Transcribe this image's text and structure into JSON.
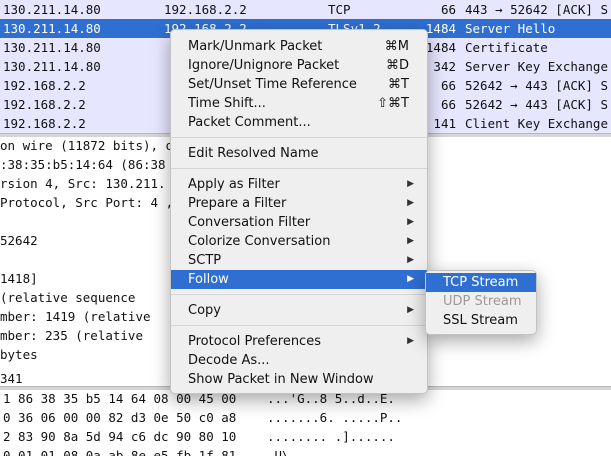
{
  "colors": {
    "selected_row": "#2f6fd1",
    "tcp_row": "#e7e6ff",
    "menu_bg": "#efefef",
    "menu_highlight": "#2f6fd1"
  },
  "packets": [
    {
      "src": "130.211.14.80",
      "dst": "192.168.2.2",
      "proto": "TCP",
      "len": "66",
      "info": "443 → 52642 [ACK] S"
    },
    {
      "src": "130.211.14.80",
      "dst": "192.168.2.2",
      "proto": "TLSv1.2",
      "len": "1484",
      "info": "Server Hello"
    },
    {
      "src": "130.211.14.80",
      "dst": "",
      "proto": "",
      "len": "1484",
      "info": "Certificate"
    },
    {
      "src": "130.211.14.80",
      "dst": "",
      "proto": "",
      "len": "342",
      "info": "Server Key Exchange"
    },
    {
      "src": "192.168.2.2",
      "dst": "",
      "proto": "",
      "len": "66",
      "info": "52642 → 443 [ACK] S"
    },
    {
      "src": "192.168.2.2",
      "dst": "",
      "proto": "",
      "len": "66",
      "info": "52642 → 443 [ACK] S"
    },
    {
      "src": "192.168.2.2",
      "dst": "",
      "proto": "",
      "len": "141",
      "info": "Client Key Exchange"
    },
    {
      "src": "",
      "dst": "",
      "proto": "",
      "len": "",
      "info": ""
    }
  ],
  "details": [
    " on wire (11872 bits),                                  on interface 0",
    ":38:35:b5:14:64 (86:38                                 f1 (a4:f1:e8:27:47:f1)",
    "rsion 4, Src: 130.211.",
    " Protocol, Src Port: 4                               , Seq: 1, Ack: 235, Len:",
    "",
    " 52642",
    "",
    " 1418]",
    "    (relative sequence",
    "mber: 1419    (relative",
    "mber: 235    (relative",
    " bytes",
    "",
    " 341"
  ],
  "hex": [
    {
      "hex": "1 86 38  35 b5 14 64 08 00 45 00",
      "ascii": "...'G..8 5..d..E."
    },
    {
      "hex": "0 36 06  00 00 82 d3 0e 50 c0 a8",
      "ascii": ".......6. .....P.."
    },
    {
      "hex": "2 83 90  8a 5d 94 c6 dc 90 80 10",
      "ascii": "........ .]......"
    },
    {
      "hex": "0 01 01  08 0a ab 8e e5 fb 1f 81",
      "ascii": ".U\\..... ........"
    }
  ],
  "context_menu": {
    "mark": {
      "label": "Mark/Unmark Packet",
      "shortcut": "⌘M"
    },
    "ignore": {
      "label": "Ignore/Unignore Packet",
      "shortcut": "⌘D"
    },
    "time_ref": {
      "label": "Set/Unset Time Reference",
      "shortcut": "⌘T"
    },
    "time_shift": {
      "label": "Time Shift...",
      "shortcut": "⇧⌘T"
    },
    "comment": {
      "label": "Packet Comment..."
    },
    "edit_resolved": {
      "label": "Edit Resolved Name"
    },
    "apply_filter": {
      "label": "Apply as Filter"
    },
    "prepare_filter": {
      "label": "Prepare a Filter"
    },
    "conversation_filter": {
      "label": "Conversation Filter"
    },
    "colorize": {
      "label": "Colorize Conversation"
    },
    "sctp": {
      "label": "SCTP"
    },
    "follow": {
      "label": "Follow"
    },
    "copy": {
      "label": "Copy"
    },
    "protocol_prefs": {
      "label": "Protocol Preferences"
    },
    "decode_as": {
      "label": "Decode As..."
    },
    "show_window": {
      "label": "Show Packet in New Window"
    }
  },
  "follow_submenu": {
    "tcp": {
      "label": "TCP Stream"
    },
    "udp": {
      "label": "UDP Stream"
    },
    "ssl": {
      "label": "SSL Stream"
    }
  }
}
